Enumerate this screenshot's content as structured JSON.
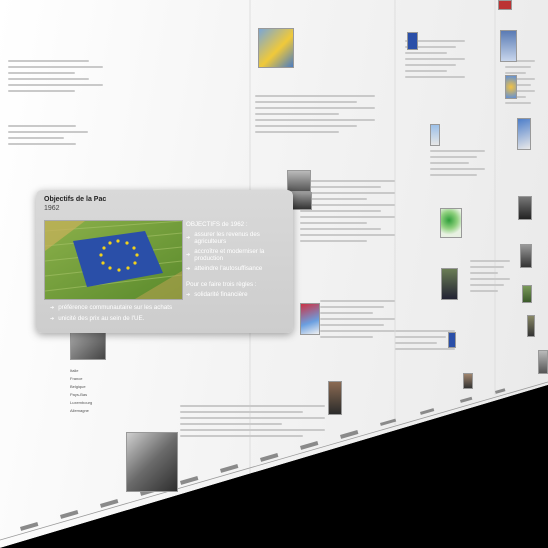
{
  "card": {
    "title": "Objectifs de la Pac",
    "year": "1962",
    "photo_caption": "EU flag drawn in a wheat field",
    "objectives_header": "OBJECTIFS de 1962 :",
    "objectives": [
      "assurer les revenus des agriculteurs",
      "accroître et moderniser la production",
      "atteindre l'autosuffisance"
    ],
    "rules_header": "Pour ce faire trois règles :",
    "rules_right": [
      "solidarité financière"
    ],
    "rules_bottom": [
      "préférence communautaire sur les achats",
      "unicité des prix au sein de l'UE."
    ]
  },
  "colors": {
    "card_bg": "#d2d2d2",
    "wall_bg": "#f2f2f2",
    "eu_blue": "#2a4fa8",
    "eu_star": "#f2d21b",
    "field_green": "#6f9a3a"
  },
  "wall_labels": {
    "left_list": [
      "Italie",
      "France",
      "Belgique",
      "Pays-Bas",
      "Luxembourg",
      "Allemagne"
    ]
  }
}
